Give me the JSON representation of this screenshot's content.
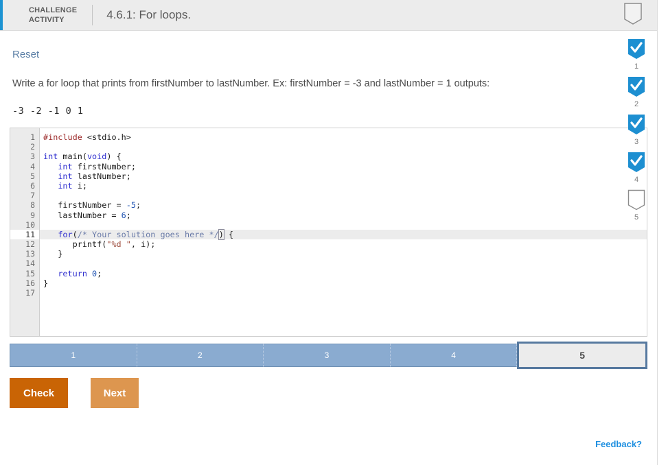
{
  "header": {
    "kicker": "CHALLENGE\nACTIVITY",
    "title": "4.6.1: For loops.",
    "accent_color": "#1d93d2",
    "shield_icon": "shield-outline-icon"
  },
  "content": {
    "reset_label": "Reset",
    "prompt": "Write a for loop that prints from firstNumber to lastNumber. Ex: firstNumber = -3 and lastNumber = 1 outputs:",
    "example_output": "-3 -2 -1 0 1"
  },
  "editor": {
    "active_line": 11,
    "line_numbers": [
      "1",
      "2",
      "3",
      "4",
      "5",
      "6",
      "7",
      "8",
      "9",
      "10",
      "11",
      "12",
      "13",
      "14",
      "15",
      "16",
      "17"
    ],
    "lines": [
      {
        "n": 1,
        "tokens": [
          {
            "t": "pre",
            "s": "#include"
          },
          {
            "t": "plain",
            "s": " <stdio.h>"
          }
        ]
      },
      {
        "n": 2,
        "tokens": []
      },
      {
        "n": 3,
        "tokens": [
          {
            "t": "type",
            "s": "int"
          },
          {
            "t": "plain",
            "s": " main("
          },
          {
            "t": "type",
            "s": "void"
          },
          {
            "t": "plain",
            "s": ") {"
          }
        ]
      },
      {
        "n": 4,
        "tokens": [
          {
            "t": "plain",
            "s": "   "
          },
          {
            "t": "type",
            "s": "int"
          },
          {
            "t": "plain",
            "s": " firstNumber;"
          }
        ]
      },
      {
        "n": 5,
        "tokens": [
          {
            "t": "plain",
            "s": "   "
          },
          {
            "t": "type",
            "s": "int"
          },
          {
            "t": "plain",
            "s": " lastNumber;"
          }
        ]
      },
      {
        "n": 6,
        "tokens": [
          {
            "t": "plain",
            "s": "   "
          },
          {
            "t": "type",
            "s": "int"
          },
          {
            "t": "plain",
            "s": " i;"
          }
        ]
      },
      {
        "n": 7,
        "tokens": []
      },
      {
        "n": 8,
        "tokens": [
          {
            "t": "plain",
            "s": "   firstNumber = "
          },
          {
            "t": "num",
            "s": "-5"
          },
          {
            "t": "plain",
            "s": ";"
          }
        ]
      },
      {
        "n": 9,
        "tokens": [
          {
            "t": "plain",
            "s": "   lastNumber = "
          },
          {
            "t": "num",
            "s": "6"
          },
          {
            "t": "plain",
            "s": ";"
          }
        ]
      },
      {
        "n": 10,
        "tokens": []
      },
      {
        "n": 11,
        "tokens": [
          {
            "t": "plain",
            "s": "   "
          },
          {
            "t": "kw",
            "s": "for"
          },
          {
            "t": "plain",
            "s": "("
          },
          {
            "t": "cmt",
            "s": "/* Your solution goes here */"
          },
          {
            "t": "caret",
            "s": ")"
          },
          {
            "t": "plain",
            "s": " {"
          }
        ]
      },
      {
        "n": 12,
        "tokens": [
          {
            "t": "plain",
            "s": "      printf("
          },
          {
            "t": "str",
            "s": "\"%d \""
          },
          {
            "t": "plain",
            "s": ", i);"
          }
        ]
      },
      {
        "n": 13,
        "tokens": [
          {
            "t": "plain",
            "s": "   }"
          }
        ]
      },
      {
        "n": 14,
        "tokens": []
      },
      {
        "n": 15,
        "tokens": [
          {
            "t": "plain",
            "s": "   "
          },
          {
            "t": "kw",
            "s": "return"
          },
          {
            "t": "plain",
            "s": " "
          },
          {
            "t": "num",
            "s": "0"
          },
          {
            "t": "plain",
            "s": ";"
          }
        ]
      },
      {
        "n": 16,
        "tokens": [
          {
            "t": "plain",
            "s": "}"
          }
        ]
      },
      {
        "n": 17,
        "tokens": []
      }
    ]
  },
  "progress": {
    "segments": [
      {
        "label": "1",
        "state": "done"
      },
      {
        "label": "2",
        "state": "done"
      },
      {
        "label": "3",
        "state": "done"
      },
      {
        "label": "4",
        "state": "done"
      },
      {
        "label": "5",
        "state": "current"
      }
    ],
    "fill_color": "#8aabd0",
    "current_border_color": "#56799f"
  },
  "actions": {
    "check_label": "Check",
    "next_label": "Next",
    "check_color": "#c96405",
    "next_color": "#dd964f"
  },
  "checkpoints": [
    {
      "label": "1",
      "checked": true
    },
    {
      "label": "2",
      "checked": true
    },
    {
      "label": "3",
      "checked": true
    },
    {
      "label": "4",
      "checked": true
    },
    {
      "label": "5",
      "checked": false
    }
  ],
  "footer": {
    "feedback_label": "Feedback?",
    "feedback_color": "#1e8fe0"
  }
}
